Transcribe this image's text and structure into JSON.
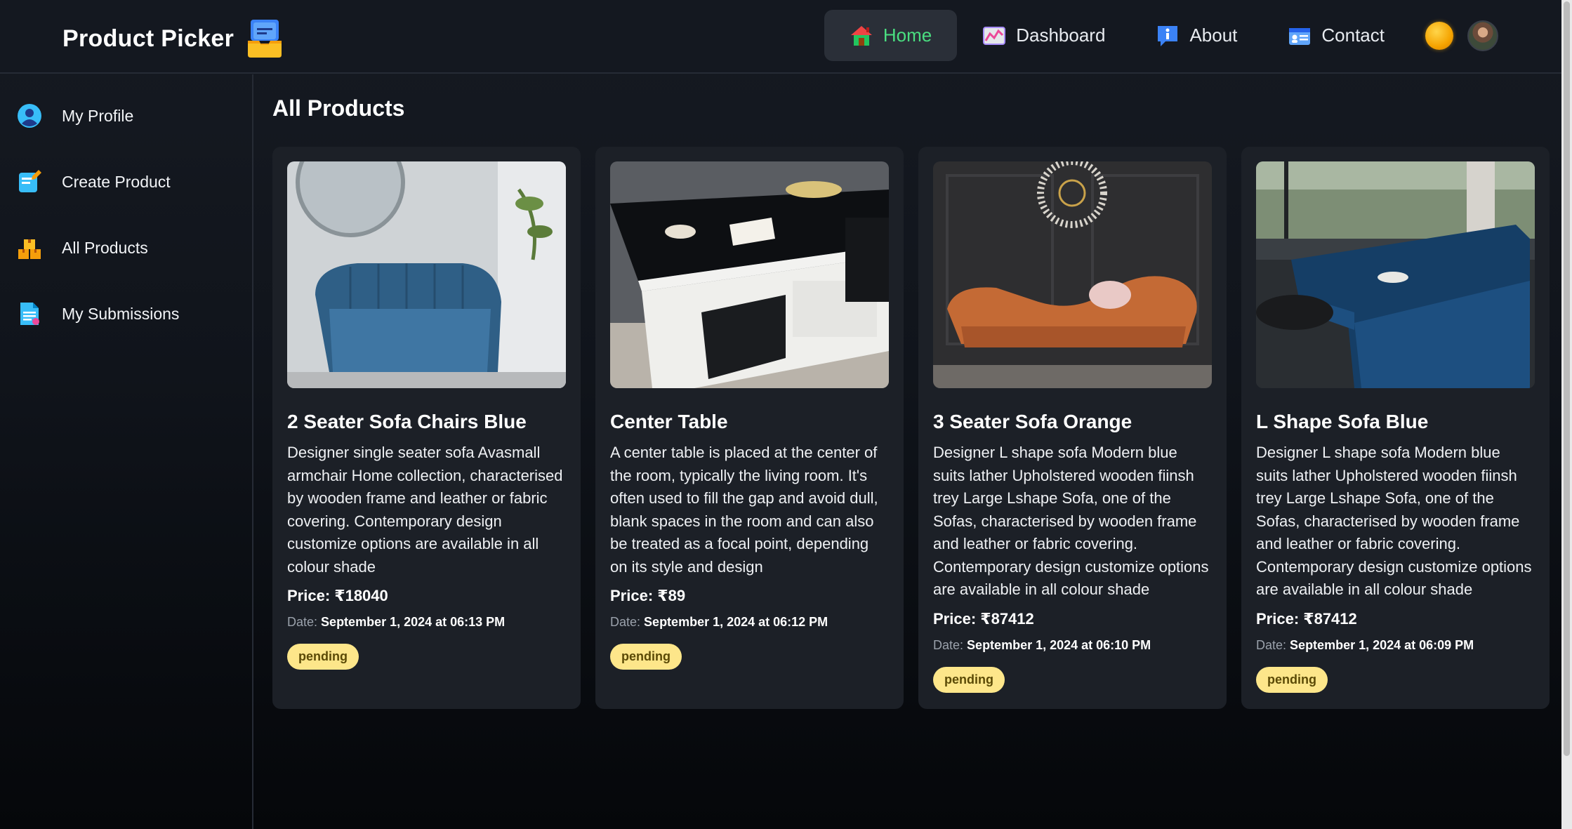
{
  "app": {
    "title": "Product Picker"
  },
  "nav": {
    "items": [
      {
        "label": "Home",
        "icon": "home-icon",
        "active": true
      },
      {
        "label": "Dashboard",
        "icon": "chart-icon",
        "active": false
      },
      {
        "label": "About",
        "icon": "info-icon",
        "active": false
      },
      {
        "label": "Contact",
        "icon": "contact-card-icon",
        "active": false
      }
    ],
    "theme_icon": "sun-icon",
    "avatar_icon": "user-avatar"
  },
  "sidebar": {
    "items": [
      {
        "label": "My Profile",
        "icon": "user-circle-icon"
      },
      {
        "label": "Create Product",
        "icon": "edit-note-icon"
      },
      {
        "label": "All Products",
        "icon": "boxes-icon"
      },
      {
        "label": "My Submissions",
        "icon": "document-icon"
      }
    ]
  },
  "main": {
    "title": "All Products",
    "products": [
      {
        "title": "2 Seater Sofa Chairs Blue",
        "description": "Designer single seater sofa Avasmall armchair Home collection, characterised by wooden frame and leather or fabric covering. Contemporary design customize options are available in all colour shade",
        "price_label": "Price:",
        "price": "₹18040",
        "date_label": "Date:",
        "date": "September 1, 2024 at 06:13 PM",
        "status": "pending"
      },
      {
        "title": "Center Table",
        "description": "A center table is placed at the center of the room, typically the living room. It's often used to fill the gap and avoid dull, blank spaces in the room and can also be treated as a focal point, depending on its style and design",
        "price_label": "Price:",
        "price": "₹89",
        "date_label": "Date:",
        "date": "September 1, 2024 at 06:12 PM",
        "status": "pending"
      },
      {
        "title": "3 Seater Sofa Orange",
        "description": "Designer L shape sofa Modern blue suits lather Upholstered wooden fiinsh trey Large Lshape Sofa, one of the Sofas, characterised by wooden frame and leather or fabric covering. Contemporary design customize options are available in all colour shade",
        "price_label": "Price:",
        "price": "₹87412",
        "date_label": "Date:",
        "date": "September 1, 2024 at 06:10 PM",
        "status": "pending"
      },
      {
        "title": "L Shape Sofa Blue",
        "description": "Designer L shape sofa Modern blue suits lather Upholstered wooden fiinsh trey Large Lshape Sofa, one of the Sofas, characterised by wooden frame and leather or fabric covering. Contemporary design customize options are available in all colour shade",
        "price_label": "Price:",
        "price": "₹87412",
        "date_label": "Date:",
        "date": "September 1, 2024 at 06:09 PM",
        "status": "pending"
      }
    ]
  },
  "colors": {
    "accent_active": "#4ade80",
    "badge_bg": "#fde68a",
    "card_bg": "#1c2027"
  }
}
